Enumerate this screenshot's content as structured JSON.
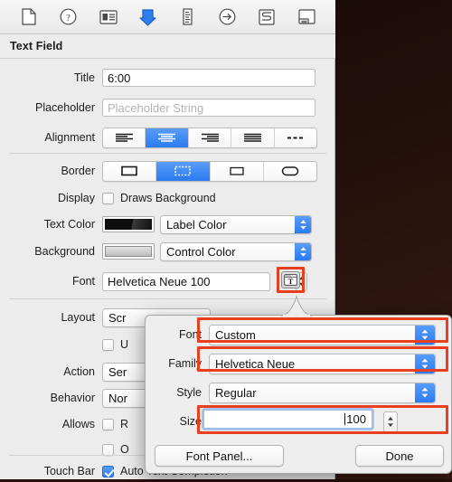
{
  "window": {
    "app": "Interface Builder Attributes Inspector",
    "backdrop_color": "#24100b",
    "accent_color": "#2a7bf2",
    "highlight_color": "#e8401f"
  },
  "toolbar": {
    "icons": [
      {
        "name": "file-inspector-icon",
        "label": "File Inspector",
        "selected": false
      },
      {
        "name": "quick-help-icon",
        "label": "Quick Help Inspector",
        "selected": false
      },
      {
        "name": "identity-inspector-icon",
        "label": "Identity Inspector",
        "selected": false
      },
      {
        "name": "attributes-inspector-icon",
        "label": "Attributes Inspector",
        "selected": true
      },
      {
        "name": "size-inspector-icon",
        "label": "Size Inspector",
        "selected": false
      },
      {
        "name": "connections-inspector-icon",
        "label": "Connections Inspector",
        "selected": false
      },
      {
        "name": "bindings-inspector-icon",
        "label": "Bindings Inspector",
        "selected": false
      },
      {
        "name": "view-effects-inspector-icon",
        "label": "View Effects Inspector",
        "selected": false
      }
    ]
  },
  "inspector": {
    "section_title": "Text Field",
    "rows": {
      "title": {
        "label": "Title",
        "value": "6:00"
      },
      "placeholder": {
        "label": "Placeholder",
        "placeholder": "Placeholder String",
        "value": ""
      },
      "alignment": {
        "label": "Alignment",
        "options": [
          "left",
          "center",
          "right",
          "justified",
          "natural"
        ],
        "selected_index": 1
      },
      "border": {
        "label": "Border",
        "options": [
          "none-rect",
          "line-dashed",
          "bezel",
          "rounded"
        ],
        "selected_index": 1
      },
      "display": {
        "label": "Display",
        "checkbox_label": "Draws Background",
        "checked": false
      },
      "text_color": {
        "label": "Text Color",
        "value": "Label Color",
        "swatch": "#111111"
      },
      "background": {
        "label": "Background",
        "value": "Control Color",
        "swatch": "#cccccc"
      },
      "font": {
        "label": "Font",
        "value": "Helvetica Neue 100",
        "button_icon": "font-panel-T-icon"
      },
      "layout": {
        "label": "Layout",
        "value": "Scr"
      },
      "uses_single_line": {
        "label": "",
        "checkbox_label": "U",
        "checked": false
      },
      "action": {
        "label": "Action",
        "value": "Ser"
      },
      "behavior": {
        "label": "Behavior",
        "value": "Nor"
      },
      "allows": {
        "label": "Allows",
        "checkbox_label": "R",
        "checked": false
      },
      "allows_second": {
        "label": "",
        "checkbox_label": "O",
        "checked": false
      },
      "touch_bar": {
        "label": "Touch Bar",
        "checkbox_label": "Auto Text Completion",
        "checked": true
      }
    }
  },
  "popover": {
    "rows": {
      "font": {
        "label": "Font",
        "value": "Custom",
        "highlighted": true
      },
      "family": {
        "label": "Family",
        "value": "Helvetica Neue",
        "highlighted": true
      },
      "style": {
        "label": "Style",
        "value": "Regular",
        "highlighted": false
      },
      "size": {
        "label": "Size",
        "value": "100",
        "highlighted": true,
        "focused": true
      }
    },
    "buttons": {
      "font_panel": "Font Panel...",
      "done": "Done"
    }
  }
}
